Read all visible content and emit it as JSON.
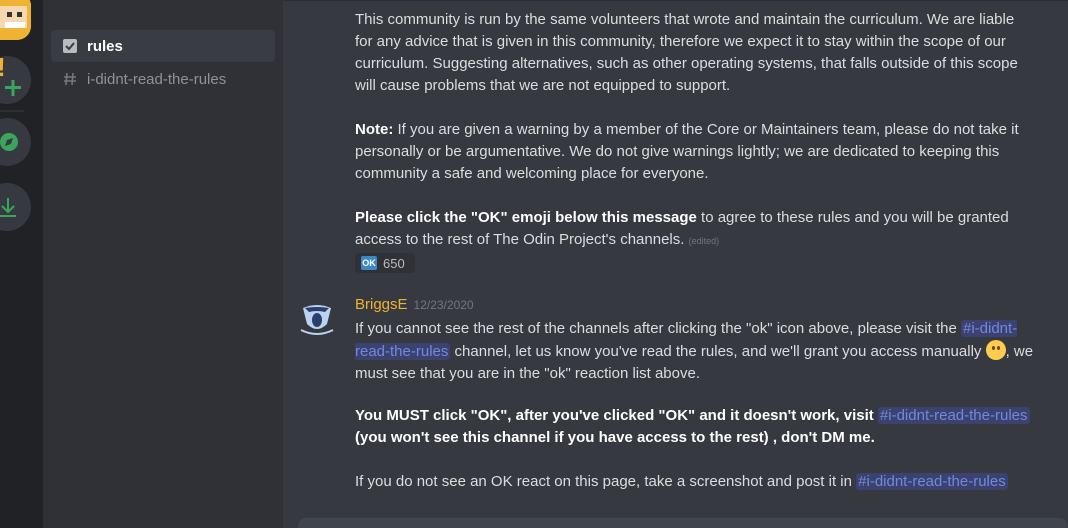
{
  "channels": {
    "active": {
      "label": "rules"
    },
    "other": {
      "label": "i-didnt-read-the-rules"
    }
  },
  "message1": {
    "para1": "This community is run by the same volunteers that wrote and maintain the curriculum. We are liable for any advice that is given in this community, therefore we expect it to stay within the scope of our curriculum. Suggesting alternatives, such as other operating systems, that falls outside of this scope will cause problems that we are not equipped to support.",
    "note_label": "Note:",
    "note_text": " If you are given a warning by a member of the Core or Maintainers team, please do not take it personally or be argumentative. We do not give warnings lightly; we are dedicated to keeping this community a safe and welcoming place for everyone.",
    "click_bold": "Please click the \"OK\" emoji below this message",
    "click_text": " to agree to these rules and you will be granted access to the rest of The Odin Project's channels.",
    "edited": "(edited)",
    "reaction_emoji": "OK",
    "reaction_count": "650"
  },
  "message2": {
    "username": "BriggsE",
    "timestamp": "12/23/2020",
    "line1_a": "If you cannot see the rest of the channels after clicking the \"ok\" icon above, please visit the ",
    "mention": "#i-didnt-read-the-rules",
    "line1_b": " channel, let us know you've read the rules, and we'll grant you access manually ",
    "line1_c": ", we must see that you are in the \"ok\" reaction list above.",
    "bold_a": "You MUST click \"OK\", after you've clicked \"OK\" and it doesn't work, visit ",
    "bold_b": "(you won't see this channel if you have access to the rest) , don't DM me.",
    "last_a": "If you do not see an OK react on this page, take a screenshot and post it in "
  },
  "icons": {
    "guild_add": "plus-icon",
    "guild_explore": "compass-icon",
    "guild_download": "download-icon",
    "channel_rules": "rules-checkbox-icon",
    "channel_text": "hashtag-icon"
  },
  "colors": {
    "accent_green": "#3ba55d",
    "mention_blue": "#7289da",
    "username_gold": "#f0b232"
  }
}
